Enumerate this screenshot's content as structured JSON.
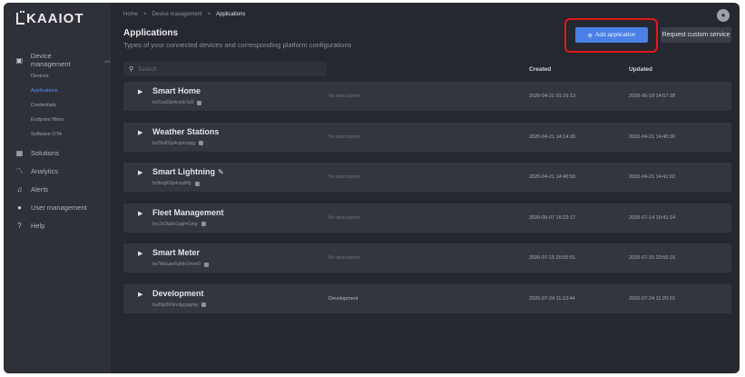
{
  "logo": "KAAIOT",
  "sidebar": {
    "device_management": "Device management",
    "sub_items": [
      "Devices",
      "Applications",
      "Credentials",
      "Endpoint filters",
      "Software OTA"
    ],
    "items": [
      {
        "label": "Solutions",
        "icon": "grid-icon"
      },
      {
        "label": "Analytics",
        "icon": "analytics-icon"
      },
      {
        "label": "Alerts",
        "icon": "bell-icon"
      },
      {
        "label": "User management",
        "icon": "user-icon"
      },
      {
        "label": "Help",
        "icon": "help-icon"
      }
    ]
  },
  "breadcrumb": {
    "home": "Home",
    "sep": ">",
    "device_management": "Device management",
    "current": "Applications"
  },
  "header": {
    "title": "Applications",
    "subtitle": "Types of your connected devices and corresponding platform configurations",
    "add_button": "Add application",
    "request_button": "Request custom service"
  },
  "search": {
    "placeholder": "Search"
  },
  "table": {
    "columns": {
      "created": "Created",
      "updated": "Updated"
    },
    "rows": [
      {
        "name": "Smart Home",
        "id": "bcf1sa03p4cqrtjr3u0",
        "description": "No description",
        "created": "2020-04-21 01:16:13",
        "updated": "2020-06-19 14:57:28"
      },
      {
        "name": "Weather Stations",
        "id": "bcf3b403p4cqsbnjejg",
        "description": "No description",
        "created": "2020-04-21 14:14:26",
        "updated": "2020-04-21 14:40:30"
      },
      {
        "name": "Smart Lightning",
        "id": "bcfbngl03p4cqslilfg",
        "description": "No description",
        "created": "2020-04-21 14:40:50",
        "updated": "2020-04-21 14:41:02"
      },
      {
        "name": "Fleet Management",
        "id": "bcc2n2tubh1aqh41mg",
        "description": "No description",
        "created": "2020-05-07 16:22:17",
        "updated": "2020-07-14 10:41:14"
      },
      {
        "name": "Smart Meter",
        "id": "bs7kk5uan6qhdv3mon0",
        "description": "No description",
        "created": "2020-07-15 20:55:51",
        "updated": "2020-07-15 20:56:16"
      },
      {
        "name": "Development",
        "id": "bsd9jd2k9mnfgcjagmg",
        "description": "Development",
        "created": "2020-07-24 11:13:44",
        "updated": "2020-07-24 11:20:20"
      }
    ]
  }
}
